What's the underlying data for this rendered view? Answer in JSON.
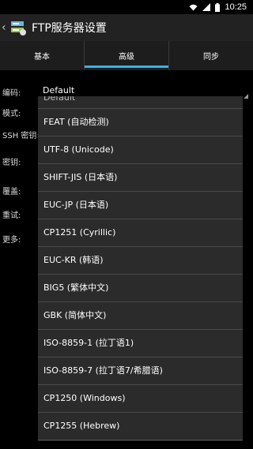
{
  "status_bar": {
    "time": "10:25",
    "icons": [
      "wifi-icon",
      "signal-icon",
      "battery-icon"
    ]
  },
  "action_bar": {
    "title": "FTP服务器设置",
    "back_icon": "chevron-left-icon",
    "app_icon": "ftp-server-app-icon"
  },
  "tabs": [
    {
      "label": "基本",
      "active": false
    },
    {
      "label": "高级",
      "active": true
    },
    {
      "label": "同步",
      "active": false
    }
  ],
  "settings": [
    {
      "label": "编码:",
      "value": "Default"
    },
    {
      "label": "模式:",
      "value": ""
    },
    {
      "label": "SSH 密钥:",
      "value": ""
    },
    {
      "label": "密钥:",
      "value": ""
    },
    {
      "label": "覆盖:",
      "value": ""
    },
    {
      "label": "重试:",
      "value": ""
    },
    {
      "label": "更多:",
      "value": ""
    }
  ],
  "dropdown": {
    "partial_item": "Default",
    "options": [
      "FEAT (自动检测)",
      "UTF-8 (Unicode)",
      "SHIFT-JIS (日本语)",
      "EUC-JP (日本语)",
      "CP1251 (Cyrillic)",
      "EUC-KR (韩语)",
      "BIG5 (繁体中文)",
      "GBK (简体中文)",
      "ISO-8859-1 (拉丁语1)",
      "ISO-8859-7 (拉丁语7/希腊语)",
      "CP1250 (Windows)",
      "CP1255 (Hebrew)"
    ]
  },
  "colors": {
    "accent": "#33b5e5",
    "background": "#000000",
    "actionbar": "#222222",
    "dropdown": "#2b2b2b"
  }
}
